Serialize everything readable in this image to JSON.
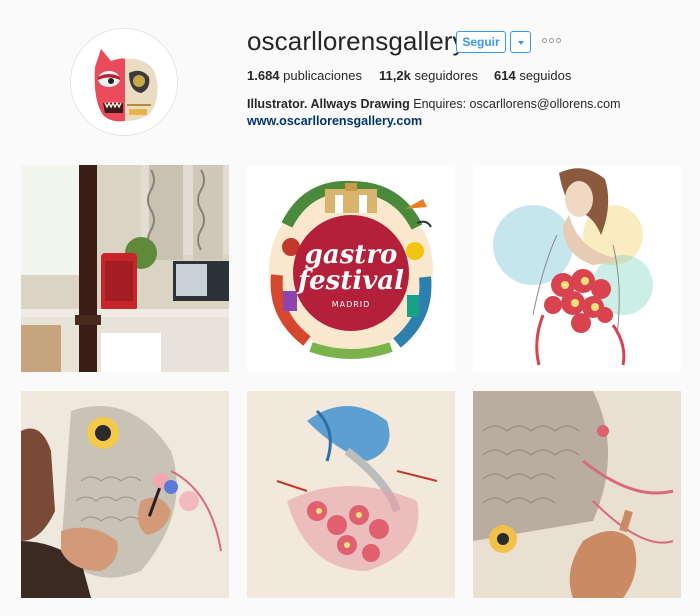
{
  "profile": {
    "username": "oscarllorensgallery",
    "follow_label": "Seguir",
    "more_icon": "ellipsis-icon",
    "dropdown_icon": "chevron-down-icon",
    "stats": {
      "posts_value": "1.684",
      "posts_label": "publicaciones",
      "followers_value": "11,2k",
      "followers_label": "seguidores",
      "following_value": "614",
      "following_label": "seguidos"
    },
    "bio": {
      "name": "Illustrator. Allways Drawing",
      "text": "Enquires: oscarllorens@ollorens.com"
    },
    "website": "www.oscarllorensgallery.com"
  },
  "posts": {
    "gastro_logo": {
      "line1": "gastro",
      "line2": "festival",
      "city": "MADRID"
    }
  },
  "colors": {
    "accent": "#3897f0",
    "link": "#003569",
    "gastro_red": "#b41f3a"
  }
}
